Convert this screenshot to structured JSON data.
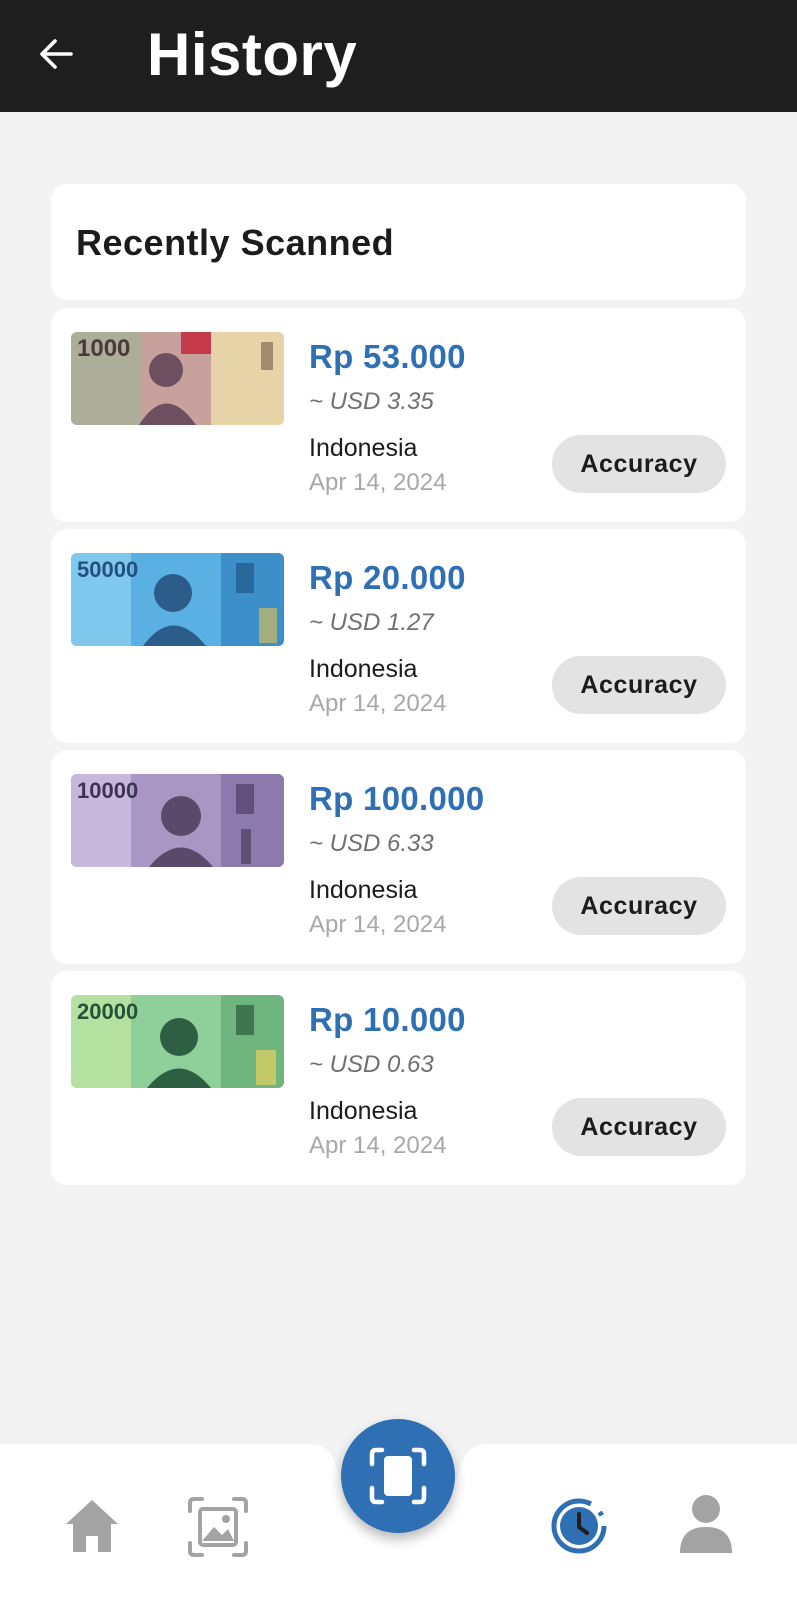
{
  "header": {
    "title": "History"
  },
  "section": {
    "title": "Recently Scanned"
  },
  "items": [
    {
      "denomination": "1000",
      "amount": "Rp 53.000",
      "usd": "~ USD 3.35",
      "country": "Indonesia",
      "date": "Apr 14, 2024",
      "button": "Accuracy",
      "note_color": "#b98a8f"
    },
    {
      "denomination": "50000",
      "amount": "Rp 20.000",
      "usd": "~ USD 1.27",
      "country": "Indonesia",
      "date": "Apr 14, 2024",
      "button": "Accuracy",
      "note_color": "#4fa6dd"
    },
    {
      "denomination": "10000",
      "amount": "Rp 100.000",
      "usd": "~ USD 6.33",
      "country": "Indonesia",
      "date": "Apr 14, 2024",
      "button": "Accuracy",
      "note_color": "#9b88b8"
    },
    {
      "denomination": "20000",
      "amount": "Rp 10.000",
      "usd": "~ USD 0.63",
      "country": "Indonesia",
      "date": "Apr 14, 2024",
      "button": "Accuracy",
      "note_color": "#7cc48b"
    }
  ],
  "nav": {
    "items": [
      "home-icon",
      "gallery-icon",
      "scan-icon",
      "history-icon",
      "profile-icon"
    ],
    "active": "history-icon",
    "accent": "#2f6fb4",
    "inactive": "#a3a3a3"
  }
}
